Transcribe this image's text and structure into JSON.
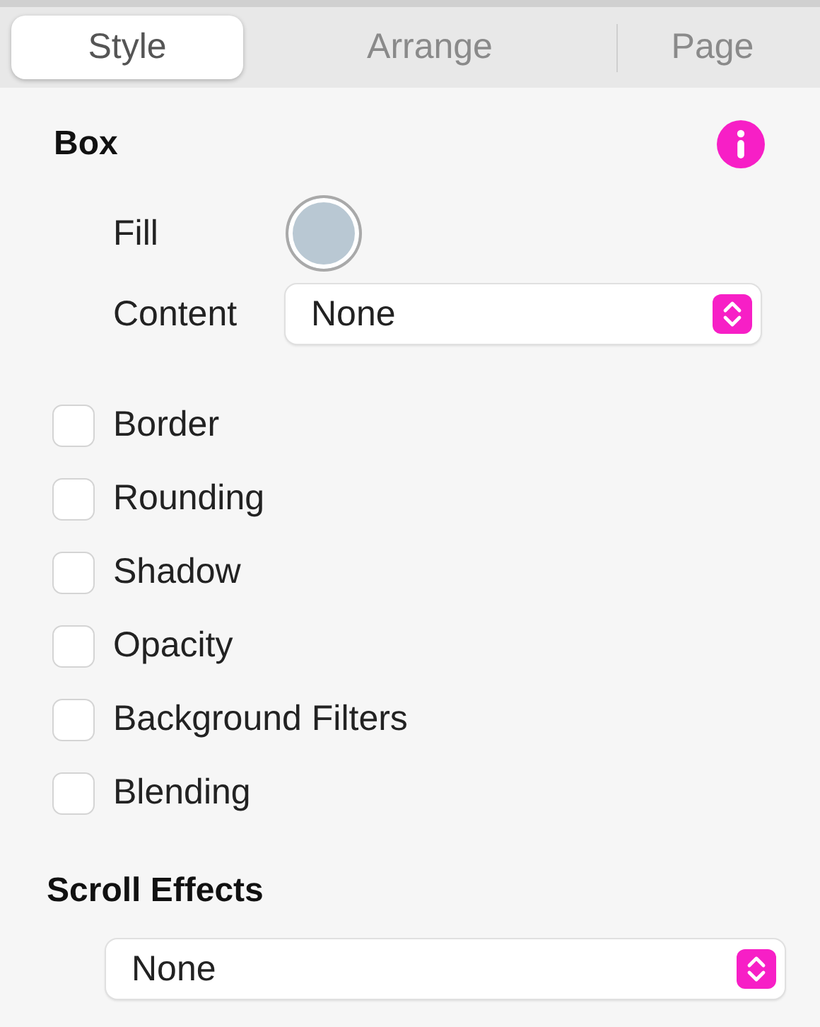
{
  "tabs": [
    {
      "label": "Style",
      "selected": true
    },
    {
      "label": "Arrange",
      "selected": false
    },
    {
      "label": "Page",
      "selected": false
    }
  ],
  "box": {
    "title": "Box",
    "fill": {
      "label": "Fill",
      "color": "#b9c8d3"
    },
    "content": {
      "label": "Content",
      "value": "None"
    }
  },
  "options": [
    {
      "label": "Border",
      "checked": false
    },
    {
      "label": "Rounding",
      "checked": false
    },
    {
      "label": "Shadow",
      "checked": false
    },
    {
      "label": "Opacity",
      "checked": false
    },
    {
      "label": "Background Filters",
      "checked": false
    },
    {
      "label": "Blending",
      "checked": false
    }
  ],
  "scroll_effects": {
    "title": "Scroll Effects",
    "value": "None"
  }
}
